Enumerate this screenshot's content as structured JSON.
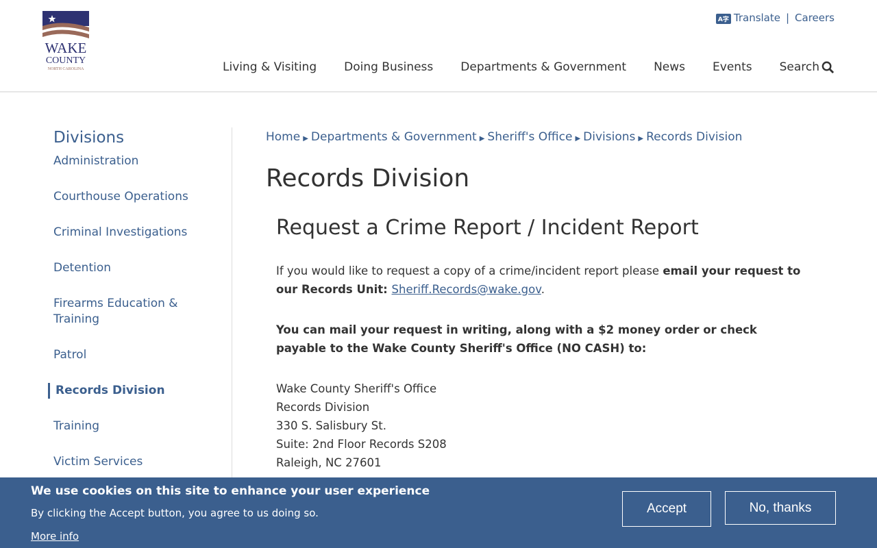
{
  "logo": {
    "line1": "WAKE",
    "line2": "COUNTY",
    "line3": "NORTH CAROLINA"
  },
  "util": {
    "translate": "Translate",
    "sep": "|",
    "careers": "Careers",
    "translate_icon": "translate-icon"
  },
  "nav": [
    "Living & Visiting",
    "Doing Business",
    "Departments & Government",
    "News",
    "Events",
    "Search"
  ],
  "sidebar": {
    "title": "Divisions",
    "items": [
      "Administration",
      "Courthouse Operations",
      "Criminal Investigations",
      "Detention",
      "Firearms Education & Training",
      "Patrol",
      "Records Division",
      "Training",
      "Victim Services"
    ],
    "active": "Records Division"
  },
  "breadcrumb": [
    "Home",
    "Departments & Government",
    "Sheriff's Office",
    "Divisions",
    "Records Division"
  ],
  "page_title": "Records Division",
  "section": {
    "title": "Request a Crime Report / Incident Report",
    "p1_a": "If you would like to request a copy of a crime/incident report please ",
    "p1_b": "email your request to our Records Unit: ",
    "p1_link": "Sheriff.Records@wake.gov",
    "p1_end": ".",
    "p2": "You can mail your request in writing, along with a $2 money order or check payable to the Wake County Sheriff's Office (NO CASH) to:",
    "address": [
      "Wake County Sheriff's Office",
      "Records Division",
      "330 S. Salisbury St.",
      "Suite: 2nd Floor Records S208",
      "Raleigh, NC 27601"
    ]
  },
  "cookie": {
    "title": "We use cookies on this site to enhance your user experience",
    "text": "By clicking the Accept button, you agree to us doing so.",
    "more": "More info",
    "accept": "Accept",
    "decline": "No, thanks"
  },
  "colors": {
    "brand": "#3b5f8e",
    "logo_navy": "#2e3272",
    "logo_brown": "#9a6a5a"
  }
}
